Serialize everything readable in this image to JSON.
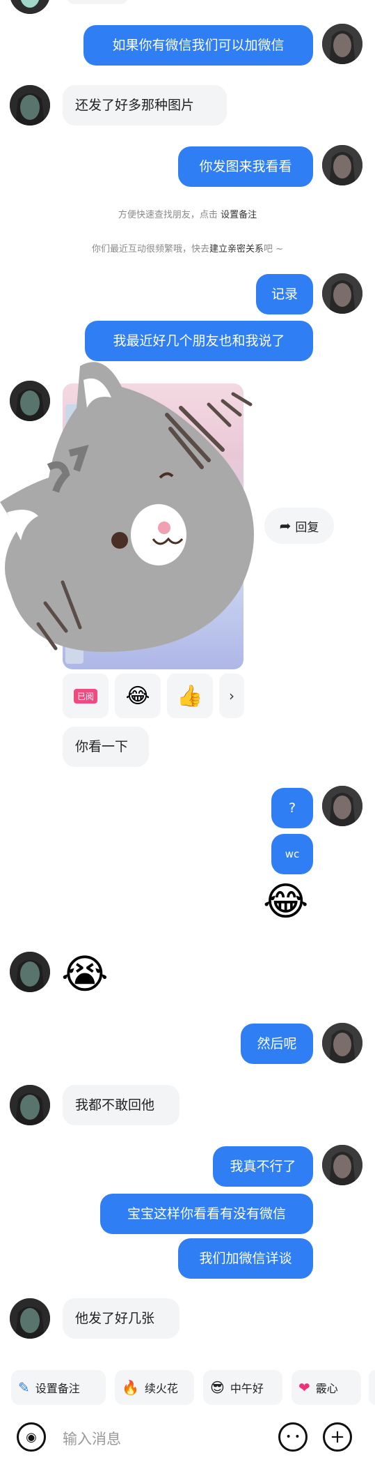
{
  "messages": {
    "m1": "如果你有微信我们可以加微信",
    "m2": "还发了好多那种图片",
    "m3": "你发图来我看看",
    "m4": "记录",
    "m5": "我最近好几个朋友也和我说了",
    "m6": "你看一下",
    "m7": "?",
    "m8": "wc",
    "m9": "然后呢",
    "m10": "我都不敢回他",
    "m11": "我真不行了",
    "m12": "宝宝这样你看看有没有微信",
    "m13": "我们加微信详谈",
    "m14": "他发了好几张"
  },
  "system": {
    "tip1_prefix": "方便快速查找朋友，点击",
    "tip1_link": "设置备注",
    "tip2_prefix": "你们最近互动很频繁哦，快去",
    "tip2_link": "建立亲密关系",
    "tip2_suffix": "吧 ~"
  },
  "shared_card": {
    "reply_label": "回复",
    "read_label": "已阅"
  },
  "quick_actions": [
    {
      "label": "设置备注",
      "icon": "pencil-icon"
    },
    {
      "label": "续火花",
      "icon": "fire-icon"
    },
    {
      "label": "中午好",
      "icon": "sunglasses-emoji-icon"
    },
    {
      "label": "霰心",
      "icon": "heart-icon"
    }
  ],
  "input": {
    "placeholder": "输入消息"
  },
  "colors": {
    "outgoing_bubble": "#2f7ef3",
    "incoming_bubble": "#f3f4f6",
    "link_text": "#333333"
  }
}
